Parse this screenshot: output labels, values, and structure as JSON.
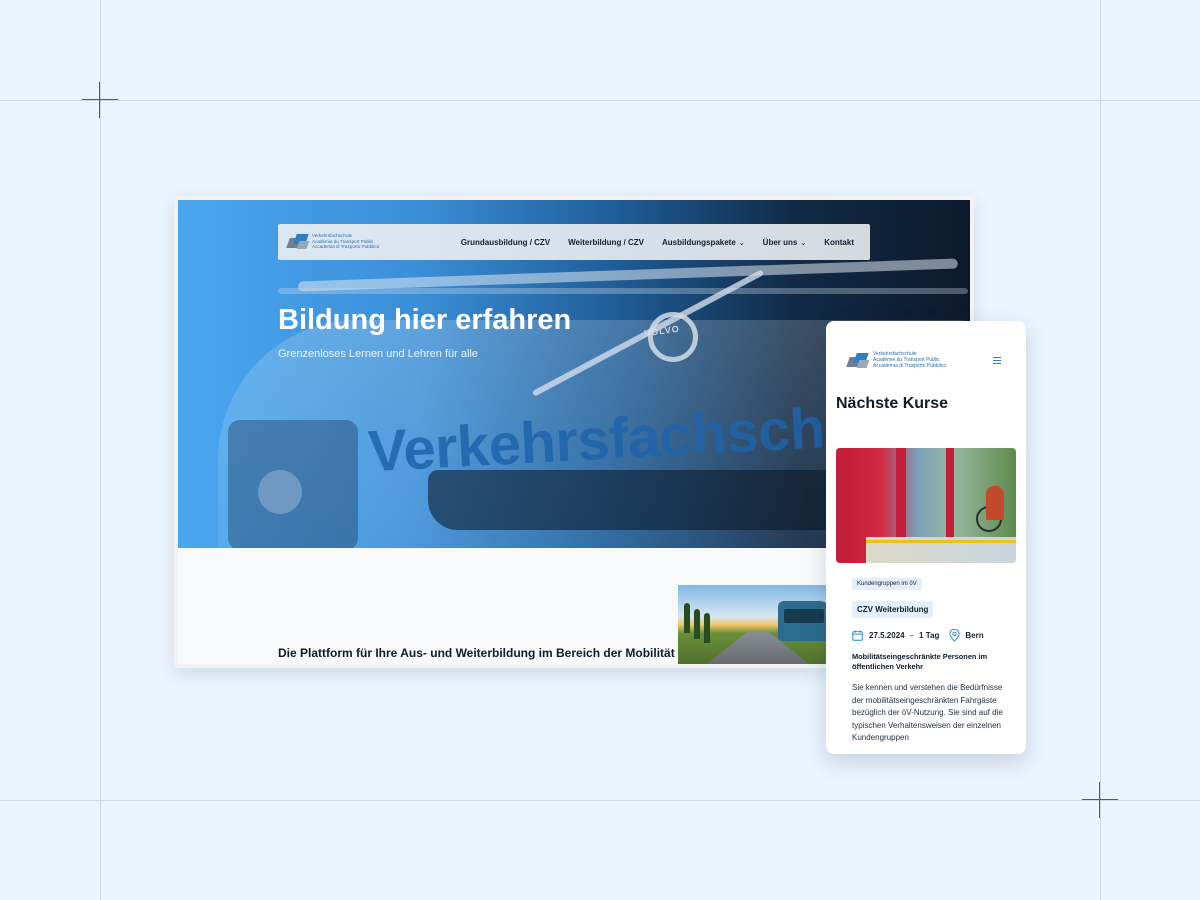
{
  "desktop": {
    "logo": {
      "lines": [
        "Verkehrsfachschule",
        "Académie du Transport Public",
        "Accademia di Trasporto Pubblico"
      ]
    },
    "nav": {
      "items": [
        {
          "label": "Grundausbildung / CZV"
        },
        {
          "label": "Weiterbildung / CZV"
        },
        {
          "label": "Ausbildungspakete",
          "dropdown": true
        },
        {
          "label": "Über uns",
          "dropdown": true
        },
        {
          "label": "Kontakt"
        }
      ]
    },
    "hero": {
      "title": "Bildung hier erfahren",
      "subtitle": "Grenzenloses Lernen und Lehren für alle",
      "bus_lettering": "Verkehrsfachschul",
      "bus_badge": "VOLVO"
    },
    "tagline": "Die Plattform für Ihre Aus- und Weiterbildung im Bereich der Mobilität"
  },
  "mobile": {
    "logo": {
      "lines": [
        "Verkehrsfachschule",
        "Académie du Transport Public",
        "Accademia di Trasporto Pubblico"
      ]
    },
    "menu_icon": "hamburger-icon",
    "heading": "Nächste Kurse",
    "course": {
      "tag": "Kundengruppen im öV",
      "category": "CZV Weiterbildung",
      "date": "27.5.2024",
      "separator": "–",
      "duration": "1 Tag",
      "location": "Bern",
      "title": "Mobilitätseingeschränkte Personen im öffentlichen Verkehr",
      "description": "Sie kennen und verstehen die Bedürfnisse der mobilitätseingeschränkten Fahrgäste bezüglich der öV-Nutzung. Sie sind auf die typischen Verhaltensweisen der einzelnen Kundengruppen"
    }
  },
  "colors": {
    "background": "#eaf4fe",
    "accent": "#2e7fc3",
    "badge": "#e3f0fb"
  }
}
